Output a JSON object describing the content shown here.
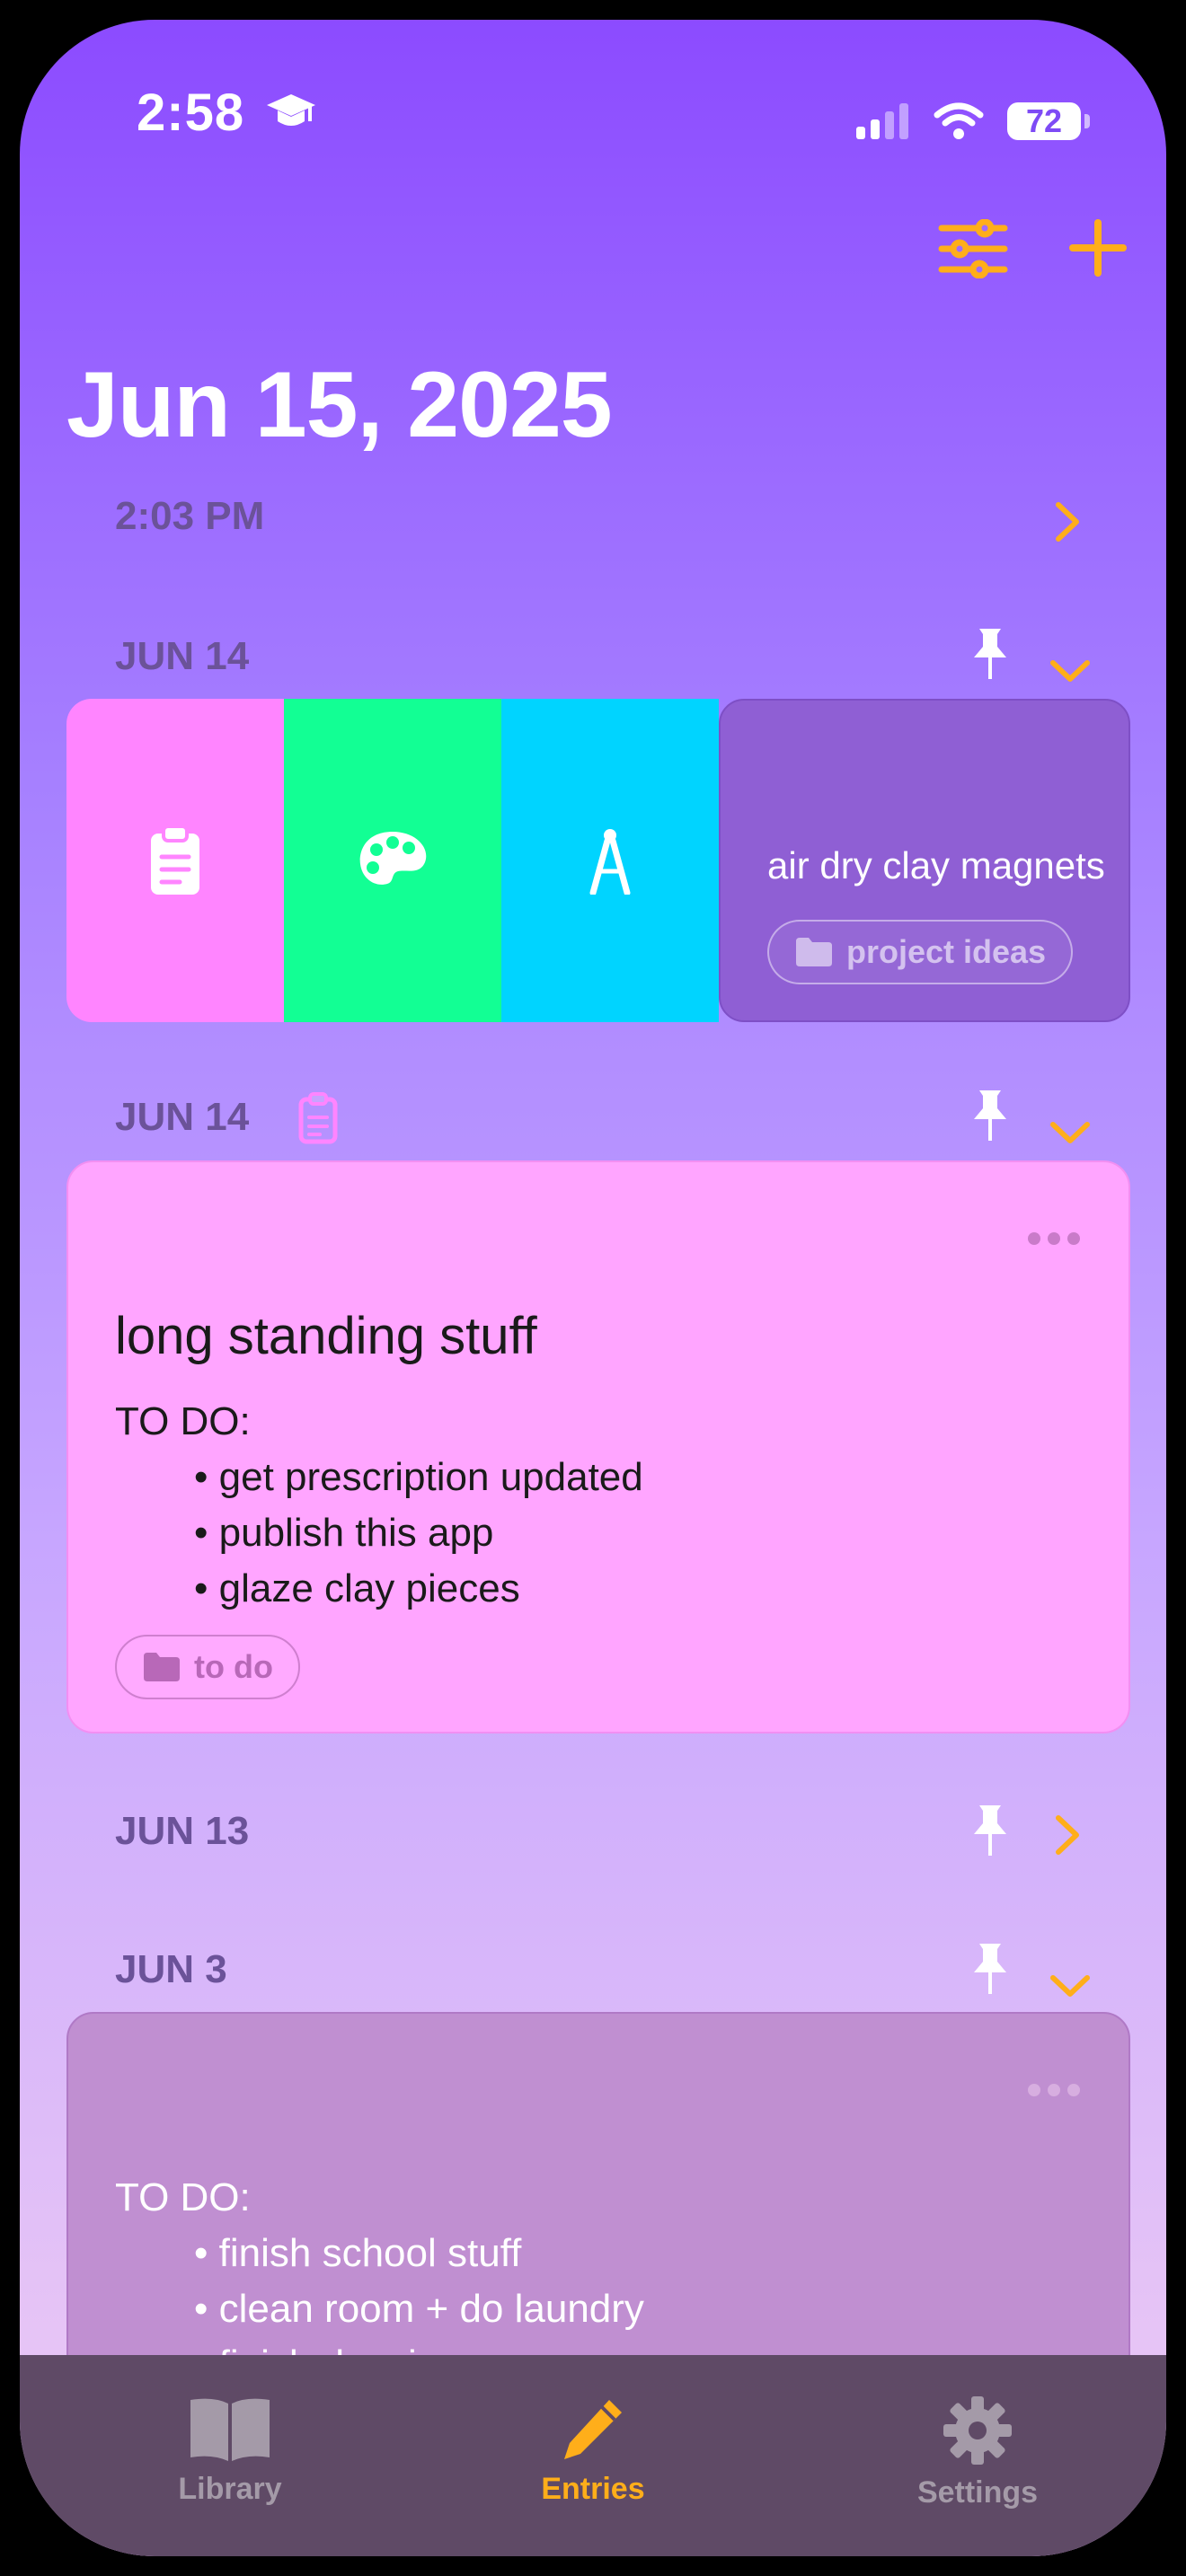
{
  "status_bar": {
    "time": "2:58",
    "battery": "72"
  },
  "header": {
    "date_title": "Jun 15, 2025"
  },
  "sections": [
    {
      "label": "2:03 PM"
    },
    {
      "label": "JUN 14"
    },
    {
      "label": "JUN 14"
    },
    {
      "label": "JUN 13"
    },
    {
      "label": "JUN 3"
    }
  ],
  "swipe_entry": {
    "text": "air dry clay magnets",
    "tag": "project ideas",
    "action_colors": [
      "#ff85ff",
      "#12ff94",
      "#00d4ff"
    ],
    "action_icons": [
      "clipboard-icon",
      "palette-icon",
      "compass-icon"
    ]
  },
  "note_entry": {
    "title": "long standing stuff",
    "heading": "TO DO:",
    "items": [
      "get prescription updated",
      "publish this app",
      "glaze clay pieces"
    ],
    "tag": "to do"
  },
  "note_entry_2": {
    "heading": "TO DO:",
    "items": [
      "finish school stuff",
      "clean room + do laundry",
      "finish drawings"
    ]
  },
  "tabbar": {
    "library": "Library",
    "entries": "Entries",
    "settings": "Settings",
    "active_color": "#ffae1a",
    "inactive_color": "#a49aa8"
  }
}
